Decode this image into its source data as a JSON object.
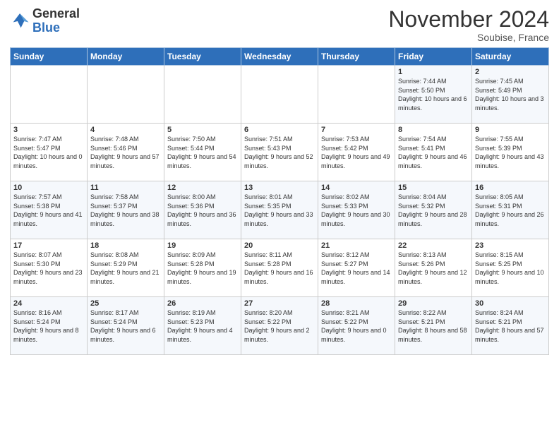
{
  "logo": {
    "text_general": "General",
    "text_blue": "Blue"
  },
  "title": "November 2024",
  "location": "Soubise, France",
  "days_of_week": [
    "Sunday",
    "Monday",
    "Tuesday",
    "Wednesday",
    "Thursday",
    "Friday",
    "Saturday"
  ],
  "weeks": [
    [
      {
        "day": "",
        "sunrise": "",
        "sunset": "",
        "daylight": ""
      },
      {
        "day": "",
        "sunrise": "",
        "sunset": "",
        "daylight": ""
      },
      {
        "day": "",
        "sunrise": "",
        "sunset": "",
        "daylight": ""
      },
      {
        "day": "",
        "sunrise": "",
        "sunset": "",
        "daylight": ""
      },
      {
        "day": "",
        "sunrise": "",
        "sunset": "",
        "daylight": ""
      },
      {
        "day": "1",
        "sunrise": "Sunrise: 7:44 AM",
        "sunset": "Sunset: 5:50 PM",
        "daylight": "Daylight: 10 hours and 6 minutes."
      },
      {
        "day": "2",
        "sunrise": "Sunrise: 7:45 AM",
        "sunset": "Sunset: 5:49 PM",
        "daylight": "Daylight: 10 hours and 3 minutes."
      }
    ],
    [
      {
        "day": "3",
        "sunrise": "Sunrise: 7:47 AM",
        "sunset": "Sunset: 5:47 PM",
        "daylight": "Daylight: 10 hours and 0 minutes."
      },
      {
        "day": "4",
        "sunrise": "Sunrise: 7:48 AM",
        "sunset": "Sunset: 5:46 PM",
        "daylight": "Daylight: 9 hours and 57 minutes."
      },
      {
        "day": "5",
        "sunrise": "Sunrise: 7:50 AM",
        "sunset": "Sunset: 5:44 PM",
        "daylight": "Daylight: 9 hours and 54 minutes."
      },
      {
        "day": "6",
        "sunrise": "Sunrise: 7:51 AM",
        "sunset": "Sunset: 5:43 PM",
        "daylight": "Daylight: 9 hours and 52 minutes."
      },
      {
        "day": "7",
        "sunrise": "Sunrise: 7:53 AM",
        "sunset": "Sunset: 5:42 PM",
        "daylight": "Daylight: 9 hours and 49 minutes."
      },
      {
        "day": "8",
        "sunrise": "Sunrise: 7:54 AM",
        "sunset": "Sunset: 5:41 PM",
        "daylight": "Daylight: 9 hours and 46 minutes."
      },
      {
        "day": "9",
        "sunrise": "Sunrise: 7:55 AM",
        "sunset": "Sunset: 5:39 PM",
        "daylight": "Daylight: 9 hours and 43 minutes."
      }
    ],
    [
      {
        "day": "10",
        "sunrise": "Sunrise: 7:57 AM",
        "sunset": "Sunset: 5:38 PM",
        "daylight": "Daylight: 9 hours and 41 minutes."
      },
      {
        "day": "11",
        "sunrise": "Sunrise: 7:58 AM",
        "sunset": "Sunset: 5:37 PM",
        "daylight": "Daylight: 9 hours and 38 minutes."
      },
      {
        "day": "12",
        "sunrise": "Sunrise: 8:00 AM",
        "sunset": "Sunset: 5:36 PM",
        "daylight": "Daylight: 9 hours and 36 minutes."
      },
      {
        "day": "13",
        "sunrise": "Sunrise: 8:01 AM",
        "sunset": "Sunset: 5:35 PM",
        "daylight": "Daylight: 9 hours and 33 minutes."
      },
      {
        "day": "14",
        "sunrise": "Sunrise: 8:02 AM",
        "sunset": "Sunset: 5:33 PM",
        "daylight": "Daylight: 9 hours and 30 minutes."
      },
      {
        "day": "15",
        "sunrise": "Sunrise: 8:04 AM",
        "sunset": "Sunset: 5:32 PM",
        "daylight": "Daylight: 9 hours and 28 minutes."
      },
      {
        "day": "16",
        "sunrise": "Sunrise: 8:05 AM",
        "sunset": "Sunset: 5:31 PM",
        "daylight": "Daylight: 9 hours and 26 minutes."
      }
    ],
    [
      {
        "day": "17",
        "sunrise": "Sunrise: 8:07 AM",
        "sunset": "Sunset: 5:30 PM",
        "daylight": "Daylight: 9 hours and 23 minutes."
      },
      {
        "day": "18",
        "sunrise": "Sunrise: 8:08 AM",
        "sunset": "Sunset: 5:29 PM",
        "daylight": "Daylight: 9 hours and 21 minutes."
      },
      {
        "day": "19",
        "sunrise": "Sunrise: 8:09 AM",
        "sunset": "Sunset: 5:28 PM",
        "daylight": "Daylight: 9 hours and 19 minutes."
      },
      {
        "day": "20",
        "sunrise": "Sunrise: 8:11 AM",
        "sunset": "Sunset: 5:28 PM",
        "daylight": "Daylight: 9 hours and 16 minutes."
      },
      {
        "day": "21",
        "sunrise": "Sunrise: 8:12 AM",
        "sunset": "Sunset: 5:27 PM",
        "daylight": "Daylight: 9 hours and 14 minutes."
      },
      {
        "day": "22",
        "sunrise": "Sunrise: 8:13 AM",
        "sunset": "Sunset: 5:26 PM",
        "daylight": "Daylight: 9 hours and 12 minutes."
      },
      {
        "day": "23",
        "sunrise": "Sunrise: 8:15 AM",
        "sunset": "Sunset: 5:25 PM",
        "daylight": "Daylight: 9 hours and 10 minutes."
      }
    ],
    [
      {
        "day": "24",
        "sunrise": "Sunrise: 8:16 AM",
        "sunset": "Sunset: 5:24 PM",
        "daylight": "Daylight: 9 hours and 8 minutes."
      },
      {
        "day": "25",
        "sunrise": "Sunrise: 8:17 AM",
        "sunset": "Sunset: 5:24 PM",
        "daylight": "Daylight: 9 hours and 6 minutes."
      },
      {
        "day": "26",
        "sunrise": "Sunrise: 8:19 AM",
        "sunset": "Sunset: 5:23 PM",
        "daylight": "Daylight: 9 hours and 4 minutes."
      },
      {
        "day": "27",
        "sunrise": "Sunrise: 8:20 AM",
        "sunset": "Sunset: 5:22 PM",
        "daylight": "Daylight: 9 hours and 2 minutes."
      },
      {
        "day": "28",
        "sunrise": "Sunrise: 8:21 AM",
        "sunset": "Sunset: 5:22 PM",
        "daylight": "Daylight: 9 hours and 0 minutes."
      },
      {
        "day": "29",
        "sunrise": "Sunrise: 8:22 AM",
        "sunset": "Sunset: 5:21 PM",
        "daylight": "Daylight: 8 hours and 58 minutes."
      },
      {
        "day": "30",
        "sunrise": "Sunrise: 8:24 AM",
        "sunset": "Sunset: 5:21 PM",
        "daylight": "Daylight: 8 hours and 57 minutes."
      }
    ]
  ]
}
